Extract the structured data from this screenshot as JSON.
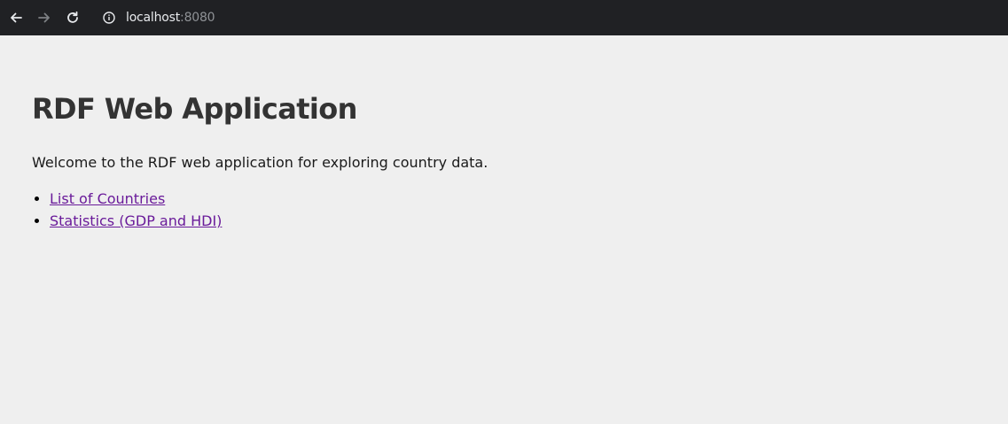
{
  "browser": {
    "url_host": "localhost",
    "url_port": ":8080"
  },
  "main": {
    "title": "RDF Web Application",
    "intro": "Welcome to the RDF web application for exploring country data.",
    "links": [
      {
        "label": "List of Countries"
      },
      {
        "label": "Statistics (GDP and HDI)"
      }
    ]
  },
  "colors": {
    "toolbar": "#202124",
    "page_bg": "#efefef",
    "heading": "#333333",
    "link_visited": "#6a1b9a"
  }
}
